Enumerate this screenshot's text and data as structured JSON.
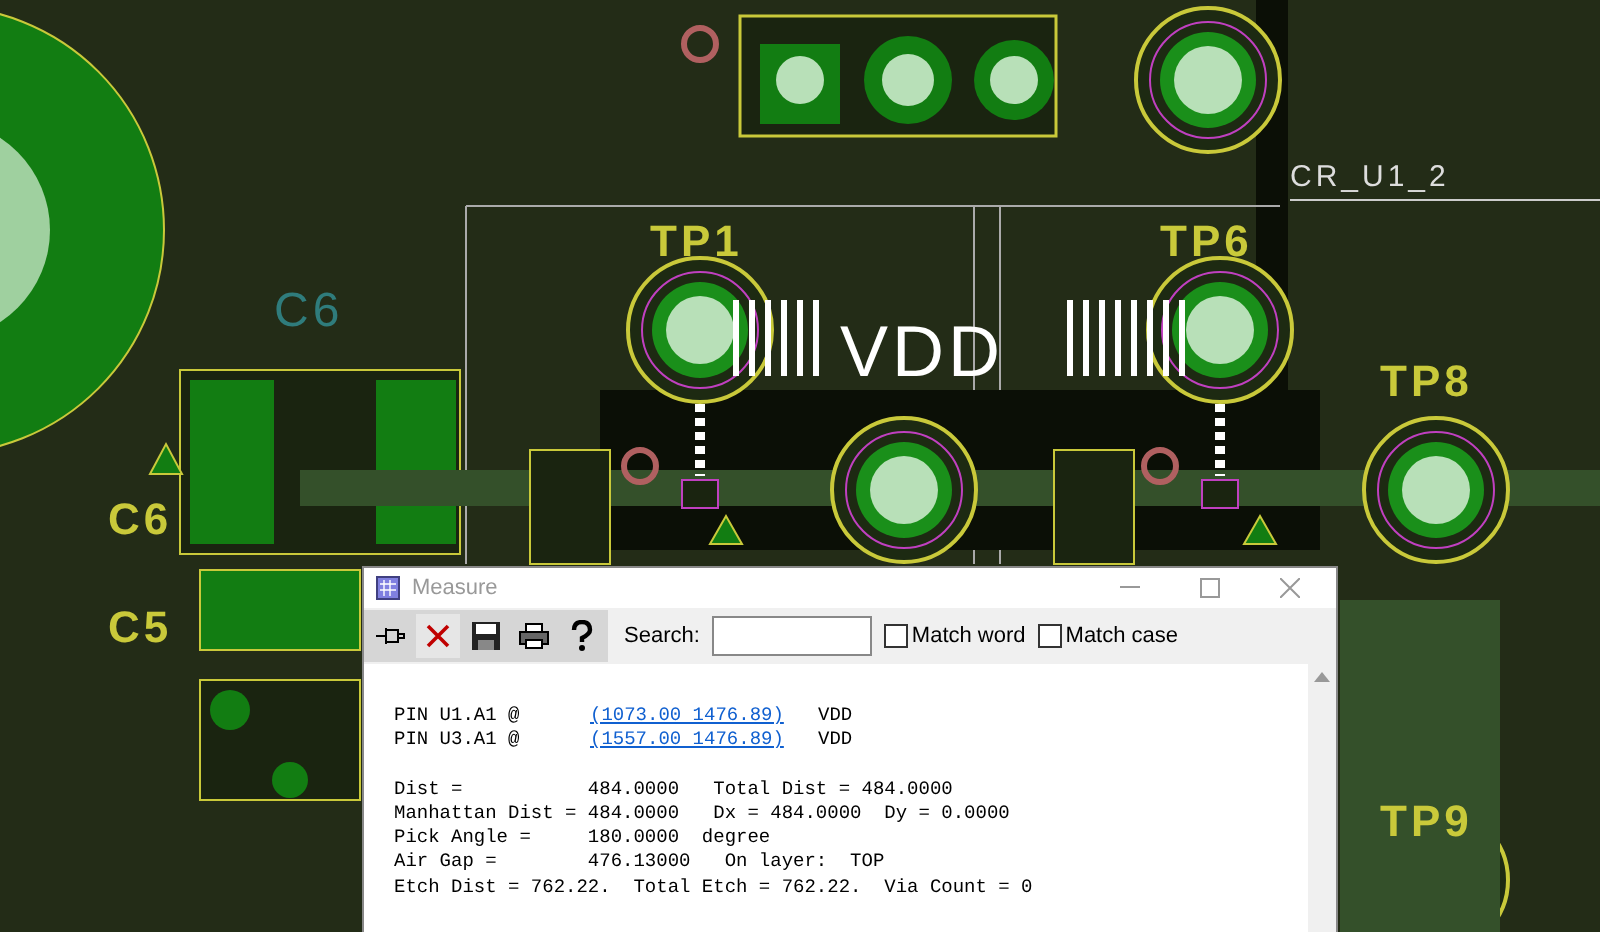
{
  "board": {
    "labels": [
      {
        "kind": "testpoint",
        "text": "TP1"
      },
      {
        "kind": "testpoint",
        "text": "TP6"
      },
      {
        "kind": "testpoint",
        "text": "TP8"
      },
      {
        "kind": "testpoint",
        "text": "TP9"
      },
      {
        "kind": "refdes",
        "text": "C6"
      },
      {
        "kind": "refdes",
        "text": "C5"
      },
      {
        "kind": "outline",
        "text": "C6"
      },
      {
        "kind": "net",
        "text": "VDD"
      },
      {
        "kind": "name",
        "text": "CR_U1_2"
      }
    ]
  },
  "measure": {
    "title": "Measure",
    "search": {
      "label": "Search:"
    },
    "options": [
      {
        "label": "Match word",
        "checked": false
      },
      {
        "label": "Match case",
        "checked": false
      }
    ],
    "pins": [
      {
        "pin": "PIN U1.A1 @",
        "coords": "(1073.00 1476.89)",
        "net": "VDD"
      },
      {
        "pin": "PIN U3.A1 @",
        "coords": "(1557.00 1476.89)",
        "net": "VDD"
      }
    ],
    "lines": [
      "Dist =           484.0000   Total Dist = 484.0000",
      "Manhattan Dist = 484.0000   Dx = 484.0000  Dy = 0.0000",
      "Pick Angle =     180.0000  degree",
      "Air Gap =        476.13000   On layer:  TOP",
      "Etch Dist = 762.22.  Total Etch = 762.22.  Via Count = 0"
    ]
  }
}
